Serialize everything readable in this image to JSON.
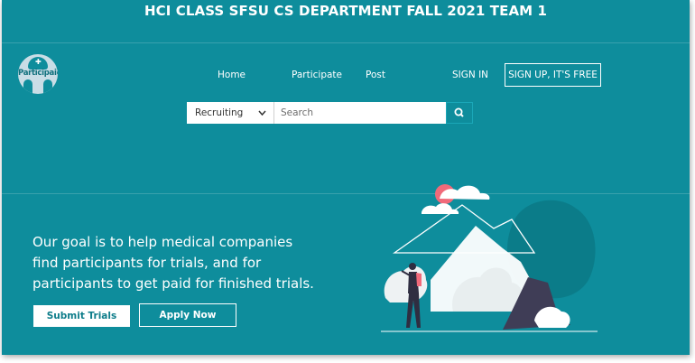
{
  "banner": {
    "title": "HCI CLASS SFSU CS DEPARTMENT FALL 2021 TEAM 1"
  },
  "logo": {
    "text": "Participaid"
  },
  "nav": {
    "home": "Home",
    "participate": "Participate",
    "post": "Post",
    "sign_in": "SIGN IN",
    "sign_up": "SIGN UP, IT'S FREE"
  },
  "search": {
    "category_selected": "Recruiting",
    "placeholder": "Search",
    "value": ""
  },
  "hero": {
    "goal_text": "Our goal is to help medical companies find participants for trials, and for participants to get paid for finished trials.",
    "submit_trials_label": "Submit Trials",
    "apply_now_label": "Apply Now"
  },
  "icons": {
    "search": "search-icon",
    "chevron": "chevron-down-icon",
    "logo_nurse": "nurse-cap-icon"
  },
  "colors": {
    "background": "#0e8d9c",
    "sun": "#f06a7a",
    "text": "#ffffff",
    "button_text": "#0e7d8a"
  }
}
